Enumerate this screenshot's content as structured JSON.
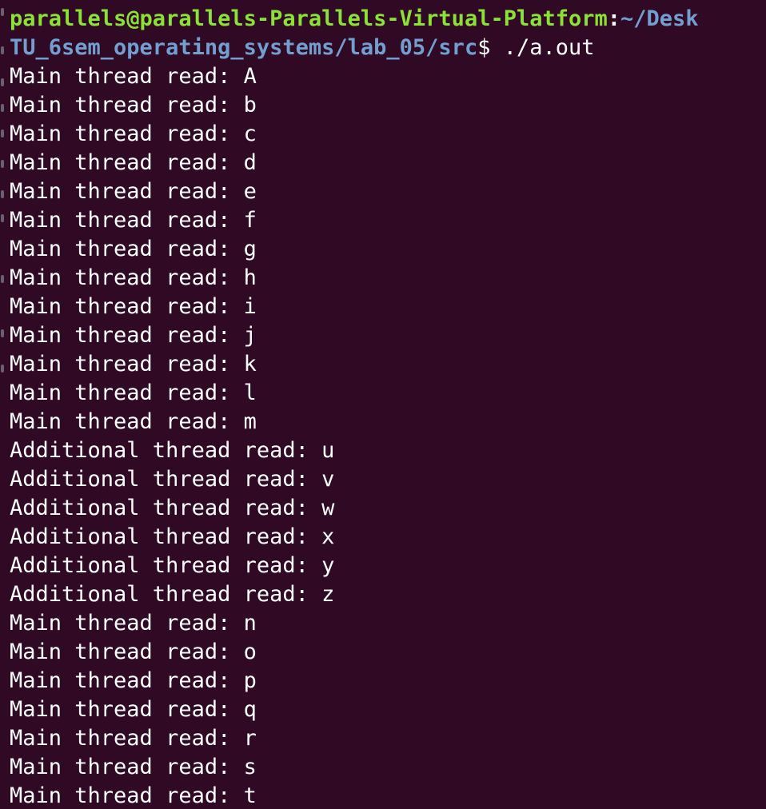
{
  "terminal": {
    "prompt": {
      "user_host": "parallels@parallels-Parallels-Virtual-Platform",
      "separator": ":",
      "path_line1": "~/Desk",
      "path_line2": "TU_6sem_operating_systems/lab_05/src",
      "dollar": "$",
      "command": " ./a.out"
    },
    "output": [
      "Main thread read: A",
      "Main thread read: b",
      "Main thread read: c",
      "Main thread read: d",
      "Main thread read: e",
      "Main thread read: f",
      "Main thread read: g",
      "Main thread read: h",
      "Main thread read: i",
      "Main thread read: j",
      "Main thread read: k",
      "Main thread read: l",
      "Main thread read: m",
      "Additional thread read: u",
      "Additional thread read: v",
      "Additional thread read: w",
      "Additional thread read: x",
      "Additional thread read: y",
      "Additional thread read: z",
      "Main thread read: n",
      "Main thread read: o",
      "Main thread read: p",
      "Main thread read: q",
      "Main thread read: r",
      "Main thread read: s",
      "Main thread read: t"
    ]
  },
  "colors": {
    "background": "#300a24",
    "user_host": "#8ae234",
    "path": "#729fcf",
    "text": "#ffffff"
  }
}
